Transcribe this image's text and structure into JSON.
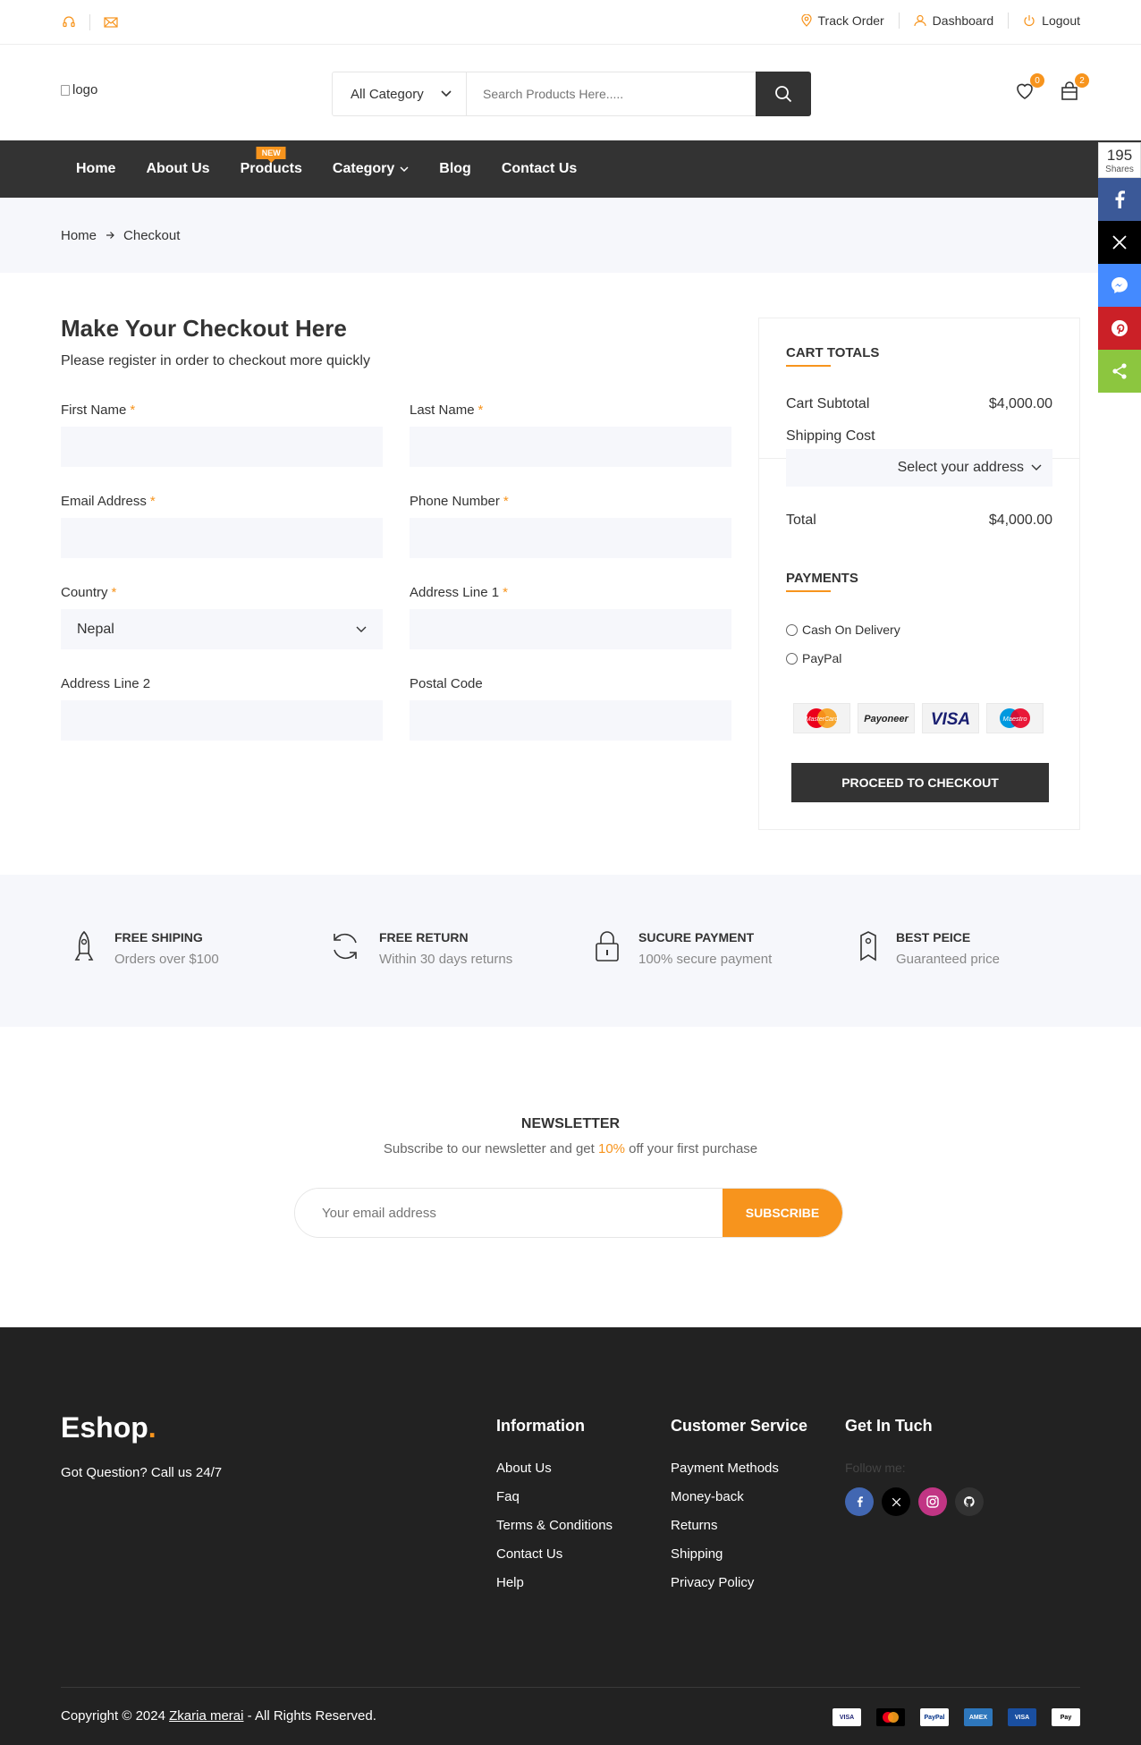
{
  "topbar": {
    "track": "Track Order",
    "dashboard": "Dashboard",
    "logout": "Logout"
  },
  "header": {
    "logo_alt": "logo",
    "category": "All Category",
    "search_placeholder": "Search Products Here.....",
    "wishlist_count": "0",
    "cart_count": "2"
  },
  "nav": {
    "items": [
      "Home",
      "About Us",
      "Products",
      "Category",
      "Blog",
      "Contact Us"
    ],
    "new_badge": "NEW"
  },
  "share": {
    "count": "195",
    "label": "Shares"
  },
  "breadcrumb": {
    "home": "Home",
    "current": "Checkout"
  },
  "checkout": {
    "title": "Make Your Checkout Here",
    "subtitle": "Please register in order to checkout more quickly",
    "fields": {
      "first_name": "First Name",
      "last_name": "Last Name",
      "email": "Email Address",
      "phone": "Phone Number",
      "country": "Country",
      "country_value": "Nepal",
      "address1": "Address Line 1",
      "address2": "Address Line 2",
      "postal": "Postal Code"
    },
    "required_mark": "*"
  },
  "totals": {
    "heading": "CART TOTALS",
    "subtotal_label": "Cart Subtotal",
    "subtotal_value": "$4,000.00",
    "shipping_label": "Shipping Cost",
    "address_select": "Select your address",
    "total_label": "Total",
    "total_value": "$4,000.00",
    "payments_heading": "PAYMENTS",
    "cod": "Cash On Delivery",
    "paypal": "PayPal",
    "card_names": [
      "MasterCard",
      "Payoneer",
      "VISA",
      "Maestro"
    ],
    "proceed": "PROCEED TO CHECKOUT"
  },
  "features": [
    {
      "title": "FREE SHIPING",
      "desc": "Orders over $100",
      "icon": "rocket-icon"
    },
    {
      "title": "FREE RETURN",
      "desc": "Within 30 days returns",
      "icon": "refresh-icon"
    },
    {
      "title": "SUCURE PAYMENT",
      "desc": "100% secure payment",
      "icon": "lock-icon"
    },
    {
      "title": "BEST PEICE",
      "desc": "Guaranteed price",
      "icon": "tag-icon"
    }
  ],
  "newsletter": {
    "title": "NEWSLETTER",
    "text_before": "Subscribe to our newsletter and get ",
    "highlight": "10%",
    "text_after": " off your first purchase",
    "placeholder": "Your email address",
    "button": "SUBSCRIBE"
  },
  "footer": {
    "brand": "Eshop",
    "brand_dot": ".",
    "question": "Got Question? Call us 24/7",
    "info_title": "Information",
    "info_links": [
      "About Us",
      "Faq",
      "Terms & Conditions",
      "Contact Us",
      "Help"
    ],
    "service_title": "Customer Service",
    "service_links": [
      "Payment Methods",
      "Money-back",
      "Returns",
      "Shipping",
      "Privacy Policy"
    ],
    "touch_title": "Get In Tuch",
    "follow": "Follow me:",
    "copyright_before": "Copyright © 2024 ",
    "copyright_name": "Zkaria merai",
    "copyright_after": " - All Rights Reserved.",
    "payment_cards": [
      "VISA",
      "MC",
      "PayPal",
      "AMEX",
      "VISA",
      "Pay"
    ]
  },
  "colors": {
    "accent": "#f7941d",
    "dark": "#333333",
    "footer": "#222222",
    "light_bg": "#f6f7fb"
  }
}
